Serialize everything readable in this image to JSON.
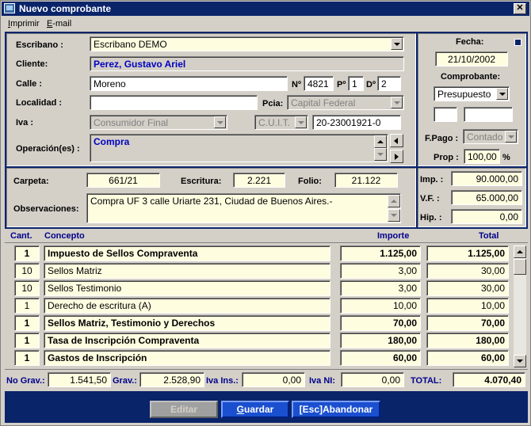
{
  "window": {
    "title": "Nuevo comprobante",
    "close_label": "✕"
  },
  "menu": {
    "items": [
      "Imprimir",
      "E-mail"
    ]
  },
  "form": {
    "escribano_label": "Escribano :",
    "escribano_value": "Escribano DEMO",
    "cliente_label": "Cliente:",
    "cliente_value": "Perez, Gustavo Ariel",
    "calle_label": "Calle :",
    "calle_value": "Moreno",
    "numero_label": "Nº",
    "numero_value": "4821",
    "piso_label": "Pº",
    "piso_value": "1",
    "depto_label": "Dº",
    "depto_value": "2",
    "localidad_label": "Localidad :",
    "localidad_value": "",
    "pcia_label": "Pcia:",
    "pcia_value": "Capital Federal",
    "iva_label": "Iva :",
    "iva_value": "Consumidor Final",
    "doc_type_value": "C.U.I.T.",
    "doc_number_value": "20-23001921-0",
    "operacion_label": "Operación(es) :",
    "operacion_value": "Compra"
  },
  "side": {
    "fecha_label": "Fecha:",
    "fecha_value": "21/10/2002",
    "comprobante_label": "Comprobante:",
    "comprobante_value": "Presupuesto",
    "box1_value": "",
    "box2_value": "",
    "fpago_label": "F.Pago :",
    "fpago_value": "Contado",
    "prop_label": "Prop :",
    "prop_value": "100,00",
    "prop_unit": "%"
  },
  "details": {
    "carpeta_label": "Carpeta:",
    "carpeta_value": "661/21",
    "escritura_label": "Escritura:",
    "escritura_value": "2.221",
    "folio_label": "Folio:",
    "folio_value": "21.122",
    "observaciones_label": "Observaciones:",
    "observaciones_value": "Compra UF 3 calle Uriarte 231, Ciudad de Buenos Aires.-"
  },
  "amounts": {
    "imp_label": "Imp. :",
    "imp_value": "90.000,00",
    "vf_label": "V.F. :",
    "vf_value": "65.000,00",
    "hip_label": "Hip. :",
    "hip_value": "0,00"
  },
  "table": {
    "headers": {
      "cant": "Cant.",
      "concepto": "Concepto",
      "importe": "Importe",
      "total": "Total"
    },
    "rows": [
      {
        "cant": "1",
        "concepto": "Impuesto de Sellos Compraventa",
        "importe": "1.125,00",
        "total": "1.125,00",
        "bold": true
      },
      {
        "cant": "10",
        "concepto": "Sellos Matriz",
        "importe": "3,00",
        "total": "30,00",
        "bold": false
      },
      {
        "cant": "10",
        "concepto": "Sellos Testimonio",
        "importe": "3,00",
        "total": "30,00",
        "bold": false
      },
      {
        "cant": "1",
        "concepto": "Derecho de escritura (A)",
        "importe": "10,00",
        "total": "10,00",
        "bold": false
      },
      {
        "cant": "1",
        "concepto": "Sellos Matriz, Testimonio y Derechos",
        "importe": "70,00",
        "total": "70,00",
        "bold": true
      },
      {
        "cant": "1",
        "concepto": "Tasa de Inscripción Compraventa",
        "importe": "180,00",
        "total": "180,00",
        "bold": true
      },
      {
        "cant": "1",
        "concepto": "Gastos de Inscripción",
        "importe": "60,00",
        "total": "60,00",
        "bold": true
      }
    ]
  },
  "totals": {
    "nograv_label": "No Grav.:",
    "nograv_value": "1.541,50",
    "grav_label": "Grav.:",
    "grav_value": "2.528,90",
    "ivains_label": "Iva Ins.:",
    "ivains_value": "0,00",
    "ivanl_label": "Iva NI:",
    "ivanl_value": "0,00",
    "total_label": "TOTAL:",
    "total_value": "4.070,40"
  },
  "buttons": {
    "editar": "Editar",
    "guardar_hot": "G",
    "guardar_rest": "uardar",
    "abandonar": "[Esc]Abandonar"
  },
  "colors": {
    "title_bg": "#0a246a",
    "field_bg": "#fffde0",
    "label_blue": "#00008b",
    "accent_button": "#1a4fcf"
  }
}
